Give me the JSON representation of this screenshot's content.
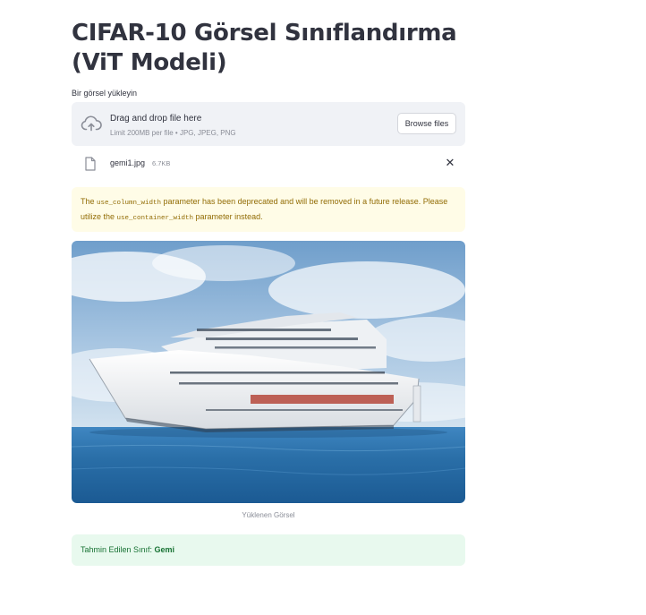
{
  "page": {
    "title": "CIFAR-10 Görsel Sınıflandırma (ViT Modeli)"
  },
  "uploader": {
    "label": "Bir görsel yükleyin",
    "drop_title": "Drag and drop file here",
    "drop_limit": "Limit 200MB per file • JPG, JPEG, PNG",
    "browse_label": "Browse files",
    "icon": "cloud-upload-icon"
  },
  "file": {
    "name": "gemi1.jpg",
    "size": "6.7KB",
    "icon": "file-icon",
    "remove_icon": "close-icon",
    "remove_glyph": "✕"
  },
  "warning": {
    "part1": "The ",
    "code1": "use_column_width",
    "part2": " parameter has been deprecated and will be removed in a future release. Please utilize the ",
    "code2": "use_container_width",
    "part3": " parameter instead."
  },
  "image": {
    "caption": "Yüklenen Görsel"
  },
  "result": {
    "label": "Tahmin Edilen Sınıf: ",
    "value": "Gemi"
  },
  "colors": {
    "dropzone_bg": "#f0f2f6",
    "warning_bg": "#fffce7",
    "warning_text": "#926c05",
    "success_bg": "#e8f9ee",
    "success_text": "#177233",
    "text": "#31333f"
  }
}
